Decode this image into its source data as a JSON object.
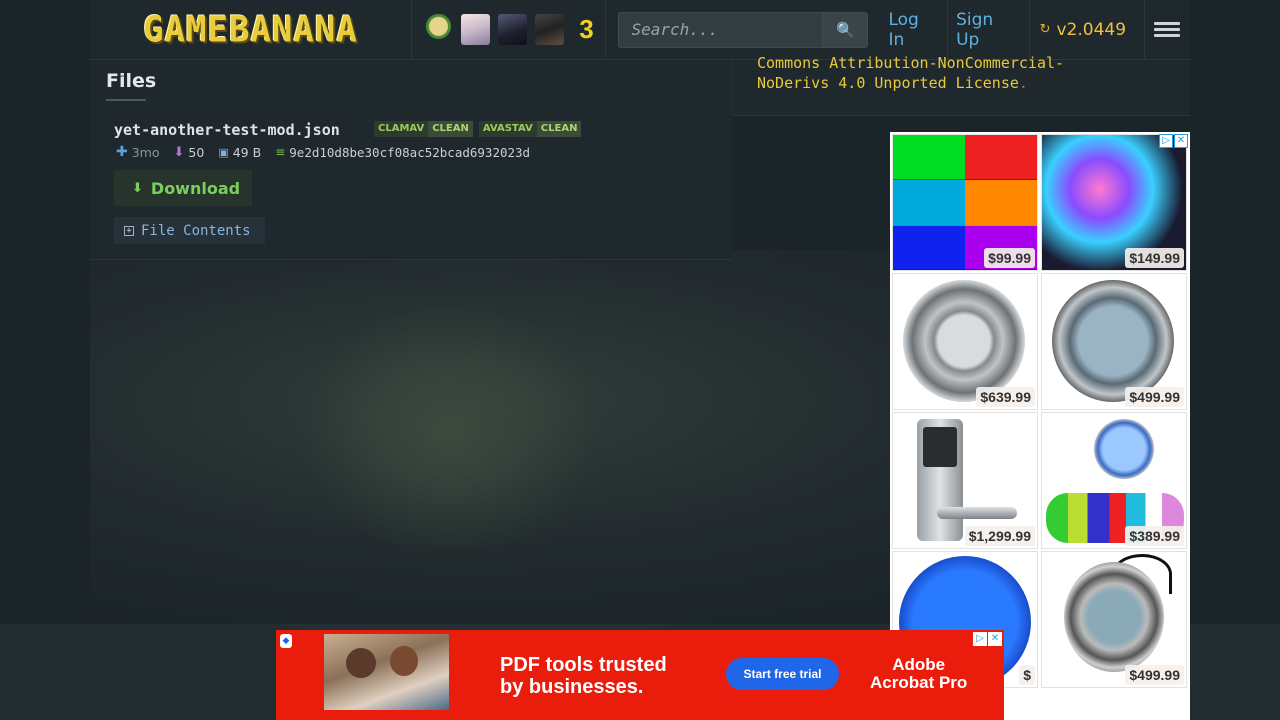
{
  "header": {
    "logo_text": "GAMEBANANA",
    "avatars": [
      "avatar-1",
      "avatar-2",
      "avatar-3",
      "avatar-4",
      "avatar-5"
    ],
    "avatar_5_text": "3",
    "search_placeholder": "Search...",
    "search_icon": "magnifier-icon",
    "login_label": "Log In",
    "signup_label": "Sign Up",
    "version_label": "v2.0449",
    "menu_icon": "hamburger-icon"
  },
  "files": {
    "heading": "Files",
    "file_name": "yet-another-test-mod.json",
    "scans": [
      {
        "engine": "CLAMAV",
        "result": "CLEAN"
      },
      {
        "engine": "AVASTAV",
        "result": "CLEAN"
      }
    ],
    "age": "3mo",
    "downloads": "50",
    "size": "49 B",
    "hash": "9e2d10d8be30cf08ac52bcad6932023d",
    "download_label": "Download",
    "file_contents_label": "File Contents"
  },
  "license": {
    "line1": "Commons Attribution-NonCommercial-",
    "line2": "NoDerivs 4.0 Unported License",
    "end": "."
  },
  "side_ad": {
    "prices": [
      "$99.99",
      "$149.99",
      "$639.99",
      "$499.99",
      "$1,299.99",
      "$389.99",
      "$",
      "$499.99"
    ]
  },
  "banner_ad": {
    "headline_1": "PDF tools trusted",
    "headline_2": "by businesses.",
    "cta": "Start free trial",
    "brand_1": "Adobe",
    "brand_2": "Acrobat Pro"
  },
  "colors": {
    "accent_link": "#5fb0e0",
    "version": "#f0c040",
    "download_green": "#7ad05a",
    "license_yellow": "#e8c93a",
    "banner_red": "#ea1c0c"
  }
}
